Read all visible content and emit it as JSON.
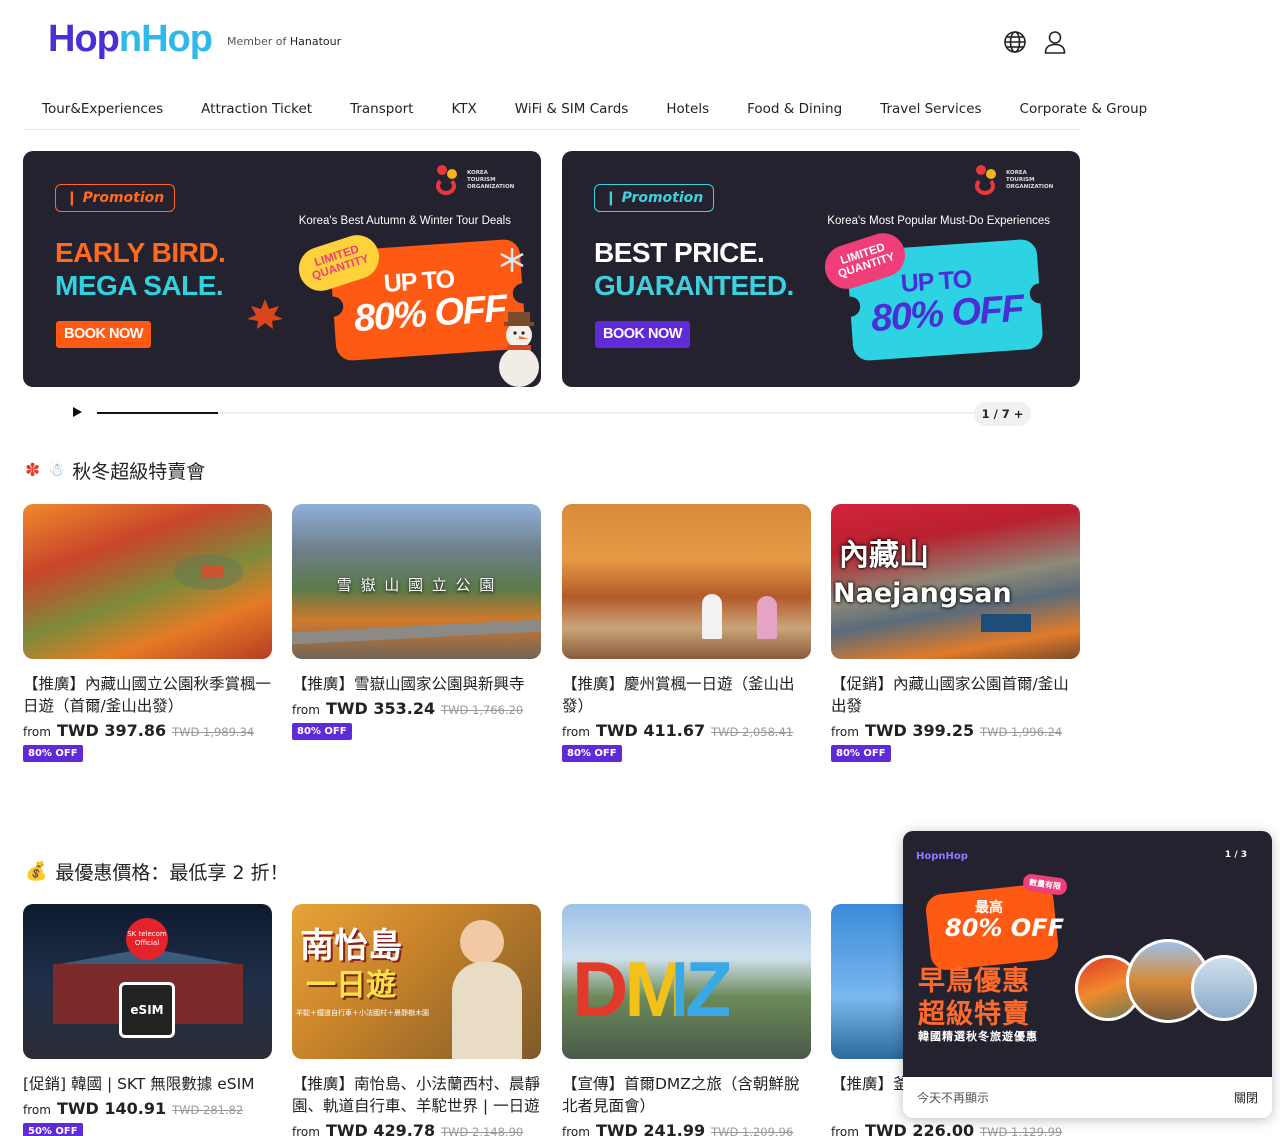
{
  "header": {
    "logo_part1": "Hop",
    "logo_part2": "nHop",
    "member_prefix": "Member of",
    "member_brand": "Hanatour"
  },
  "nav": [
    "Tour&Experiences",
    "Attraction Ticket",
    "Transport",
    "KTX",
    "WiFi & SIM Cards",
    "Hotels",
    "Food & Dining",
    "Travel Services",
    "Corporate & Group"
  ],
  "banners": [
    {
      "promo": "Promotion",
      "tagline": "Korea's Best Autumn & Winter Tour Deals",
      "head1": "EARLY BIRD.",
      "head2": "MEGA SALE.",
      "book": "BOOK NOW",
      "limited": "LIMITED QUANTITY",
      "up_to": "UP TO",
      "off": "80% OFF",
      "kto": "KOREA TOURISM ORGANIZATION",
      "colors": {
        "accent": "#ff6a1f",
        "head2": "#2fd3e0",
        "ticket": "#ff5a14",
        "ticket_text": "#ffffff"
      }
    },
    {
      "promo": "Promotion",
      "tagline": "Korea's Most Popular Must-Do Experiences",
      "head1": "BEST PRICE.",
      "head2": "GUARANTEED.",
      "book": "BOOK NOW",
      "limited": "LIMITED QUANTITY",
      "up_to": "UP TO",
      "off": "80% OFF",
      "kto": "KOREA TOURISM ORGANIZATION",
      "colors": {
        "accent": "#3fd0e0",
        "head2": "#3fd0e0",
        "ticket": "#2ed3e3",
        "ticket_text": "#4b2fd6"
      }
    }
  ],
  "carousel": {
    "counter": "1 / 7 +",
    "progress": 0.138
  },
  "section1": {
    "icons": [
      "maple-leaf-icon",
      "snowman-icon"
    ],
    "title": "秋冬超級特賣會",
    "cards": [
      {
        "title": "【推廣】內藏山國立公園秋季賞楓一日遊（首爾/釜山出發）",
        "from": "from",
        "price": "TWD 397.86",
        "orig": "TWD 1,989.34",
        "badge": "80% OFF"
      },
      {
        "title": "【推廣】雪嶽山國家公園與新興寺",
        "from": "from",
        "price": "TWD 353.24",
        "orig": "TWD 1,766.20",
        "badge": "80% OFF",
        "overlay": "雪 嶽 山 國 立 公 園"
      },
      {
        "title": "【推廣】慶州賞楓一日遊（釜山出發）",
        "from": "from",
        "price": "TWD 411.67",
        "orig": "TWD 2,058.41",
        "badge": "80% OFF"
      },
      {
        "title": "【促銷】內藏山國家公園首爾/釜山出發",
        "from": "from",
        "price": "TWD 399.25",
        "orig": "TWD 1,996.24",
        "badge": "80% OFF",
        "overlay1": "內藏山",
        "overlay2": "Naejangsan"
      }
    ]
  },
  "section2": {
    "icon": "money-bag-icon",
    "title": "最優惠價格：最低享 2 折！",
    "cards": [
      {
        "title": "[促銷] 韓國 | SKT 無限數據 eSIM",
        "from": "from",
        "price": "TWD 140.91",
        "orig": "TWD 281.82",
        "badge": "50% OFF",
        "overlay1": "SK telecom Official",
        "overlay2": "eSIM"
      },
      {
        "title": "【推廣】南怡島、小法蘭西村、晨靜園、軌道自行車、羊駝世界 | 一日遊",
        "from": "from",
        "price": "TWD 429.78",
        "orig": "TWD 2,148.90",
        "overlay1": "南怡島",
        "overlay2": "一日遊",
        "overlay3": "羊駝＋鐵道自行車＋小法國村＋晨靜樹木園"
      },
      {
        "title": "【宣傳】首爾DMZ之旅（含朝鮮脫北者見面會）",
        "from": "from",
        "price": "TWD 241.99",
        "orig": "TWD 1,209.96",
        "overlay1": "DMZ"
      },
      {
        "title": "【推廣】釜山...囊、甘川、...",
        "from": "from",
        "price": "TWD 226.00",
        "orig": "TWD 1,129.99"
      }
    ]
  },
  "popup": {
    "logo": "HopnHop",
    "counter": "1 / 3",
    "tag": "數量有限",
    "max": "最高",
    "off": "80% OFF",
    "big1": "早鳥優惠",
    "big2": "超級特賣",
    "sub": "韓國精選秋冬旅遊優惠",
    "dismiss": "今天不再顯示",
    "close": "關閉"
  }
}
